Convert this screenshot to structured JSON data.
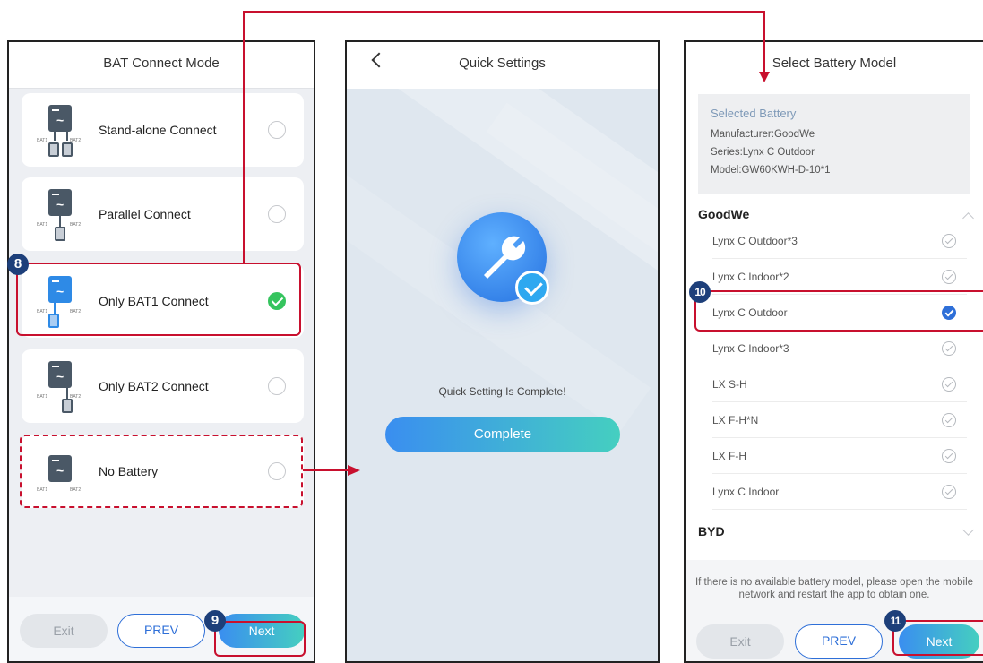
{
  "screen1": {
    "title": "BAT Connect Mode",
    "modes": [
      {
        "label": "Stand-alone Connect",
        "selected": false
      },
      {
        "label": "Parallel Connect",
        "selected": false
      },
      {
        "label": "Only BAT1 Connect",
        "selected": true
      },
      {
        "label": "Only BAT2 Connect",
        "selected": false
      },
      {
        "label": "No Battery",
        "selected": false
      }
    ],
    "icon_port_left": "BAT1",
    "icon_port_right": "BAT2",
    "buttons": {
      "exit": "Exit",
      "prev": "PREV",
      "next": "Next"
    }
  },
  "screen2": {
    "title": "Quick Settings",
    "message": "Quick Setting Is Complete!",
    "complete_button": "Complete",
    "icons": [
      "back-chevron-icon",
      "wrench-icon",
      "checkmark-icon"
    ]
  },
  "screen3": {
    "title": "Select Battery Model",
    "selected_battery": {
      "heading": "Selected Battery",
      "manufacturer": "Manufacturer:GoodWe",
      "series": "Series:Lynx C Outdoor",
      "model": "Model:GW60KWH-D-10*1"
    },
    "groups": [
      {
        "name": "GoodWe",
        "expanded": true,
        "models": [
          {
            "label": "Lynx C Outdoor*3",
            "selected": false
          },
          {
            "label": "Lynx C Indoor*2",
            "selected": false
          },
          {
            "label": "Lynx C Outdoor",
            "selected": true
          },
          {
            "label": "Lynx C Indoor*3",
            "selected": false
          },
          {
            "label": "LX S-H",
            "selected": false
          },
          {
            "label": "LX F-H*N",
            "selected": false
          },
          {
            "label": "LX F-H",
            "selected": false
          },
          {
            "label": "Lynx C Indoor",
            "selected": false
          }
        ]
      },
      {
        "name": "BYD",
        "expanded": false,
        "models": []
      }
    ],
    "footer_message": "If there is no available battery model, please open the mobile network and restart the app to obtain one.",
    "buttons": {
      "exit": "Exit",
      "prev": "PREV",
      "next": "Next"
    }
  },
  "steps": [
    "8",
    "9",
    "10",
    "11"
  ],
  "colors": {
    "annotation_red": "#c8102e",
    "step_badge": "#1d3f7a",
    "accent_blue": "#2e6fd8",
    "selected_green": "#35c45e"
  }
}
